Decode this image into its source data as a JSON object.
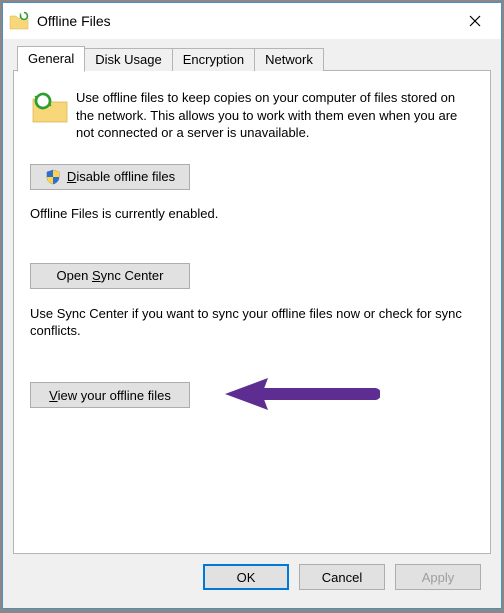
{
  "window": {
    "title": "Offline Files"
  },
  "tabs": [
    {
      "label": "General",
      "active": true
    },
    {
      "label": "Disk Usage",
      "active": false
    },
    {
      "label": "Encryption",
      "active": false
    },
    {
      "label": "Network",
      "active": false
    }
  ],
  "general": {
    "intro": "Use offline files to keep copies on your computer of files stored on the network.  This allows you to work with them even when you are not connected or a server is unavailable.",
    "disable_btn_prefix": "D",
    "disable_btn_rest": "isable offline files",
    "status": "Offline Files is currently enabled.",
    "sync_btn_prefix": "Open ",
    "sync_btn_accel": "S",
    "sync_btn_rest": "ync Center",
    "sync_desc": "Use Sync Center if you want to sync your offline files now or check for sync conflicts.",
    "view_btn_accel": "V",
    "view_btn_rest": "iew your offline files"
  },
  "footer": {
    "ok": "OK",
    "cancel": "Cancel",
    "apply": "Apply"
  },
  "colors": {
    "accent": "#0078d7",
    "arrow": "#5e2d91"
  }
}
